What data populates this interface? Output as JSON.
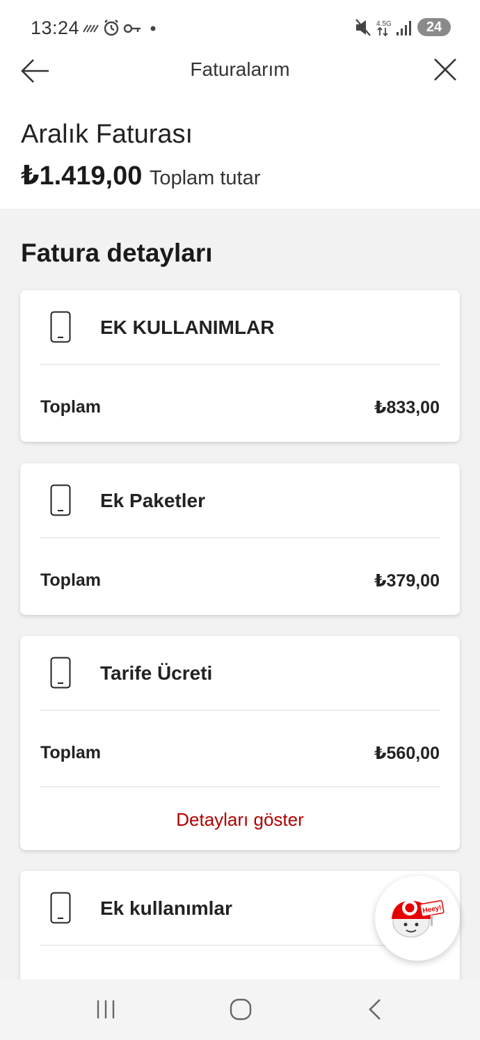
{
  "status_bar": {
    "time": "13:24",
    "network": "4.5G",
    "battery": "24"
  },
  "header": {
    "title": "Faturalarım"
  },
  "bill": {
    "title": "Aralık Faturası",
    "amount": "₺1.419,00",
    "amount_label": "Toplam tutar"
  },
  "details": {
    "section_title": "Fatura detayları",
    "cards": [
      {
        "title": "EK KULLANIMLAR",
        "total_label": "Toplam",
        "total_value": "₺833,00"
      },
      {
        "title": "Ek Paketler",
        "total_label": "Toplam",
        "total_value": "₺379,00"
      },
      {
        "title": "Tarife Ücreti",
        "total_label": "Toplam",
        "total_value": "₺560,00",
        "link": "Detayları göster"
      },
      {
        "title": "Ek kullanımlar"
      }
    ]
  },
  "chat_fab": {
    "label": "Heey!",
    "brand_color": "#e60000"
  },
  "colors": {
    "accent": "#b00000",
    "background": "#f2f2f2"
  }
}
